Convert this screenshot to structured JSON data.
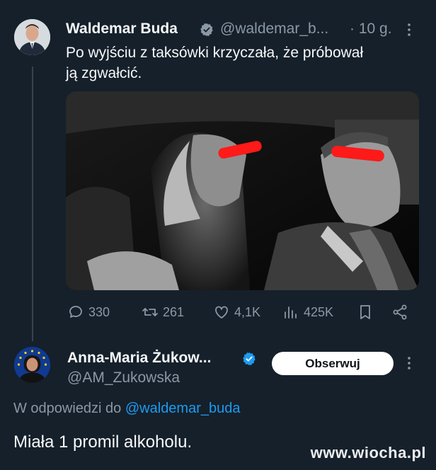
{
  "tweet": {
    "author_name": "Waldemar Buda",
    "author_handle": "@waldemar_b...",
    "time": "· 10 g.",
    "text_line1": "Po wyjściu z taksówki krzyczała, że próbował",
    "text_line2": "ją zgwałcić.",
    "stats": {
      "replies": "330",
      "retweets": "261",
      "likes": "4,1K",
      "views": "425K"
    }
  },
  "reply": {
    "author_name": "Anna-Maria Żukow...",
    "author_handle": "@AM_Zukowska",
    "follow_label": "Obserwuj",
    "reply_prefix": "W odpowiedzi do ",
    "reply_mention": "@waldemar_buda",
    "text": "Miała 1 promil alkoholu."
  },
  "watermark": "www.wiocha.pl",
  "colors": {
    "background": "#15202b",
    "muted": "#8b98a5",
    "accent": "#1d9bf0",
    "censor_bar": "#ff1a1a"
  },
  "icons": [
    "verified-badge-icon",
    "more-options-icon",
    "reply-icon",
    "retweet-icon",
    "like-icon",
    "views-icon",
    "bookmark-icon",
    "share-icon"
  ]
}
